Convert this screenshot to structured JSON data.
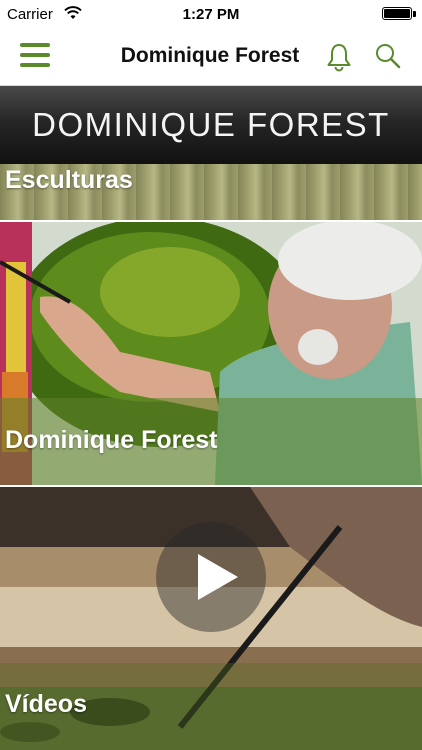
{
  "status_bar": {
    "carrier": "Carrier",
    "time": "1:27 PM"
  },
  "nav": {
    "title": "Dominique Forest",
    "icons": [
      "menu-icon",
      "bell-icon",
      "search-icon"
    ],
    "accent_color": "#5a8a2a"
  },
  "banner": {
    "text": "DOMINIQUE FOREST"
  },
  "cards": [
    {
      "label": "Esculturas"
    },
    {
      "label": "Dominique Forest"
    },
    {
      "label": "Vídeos",
      "icon": "play-icon"
    }
  ]
}
